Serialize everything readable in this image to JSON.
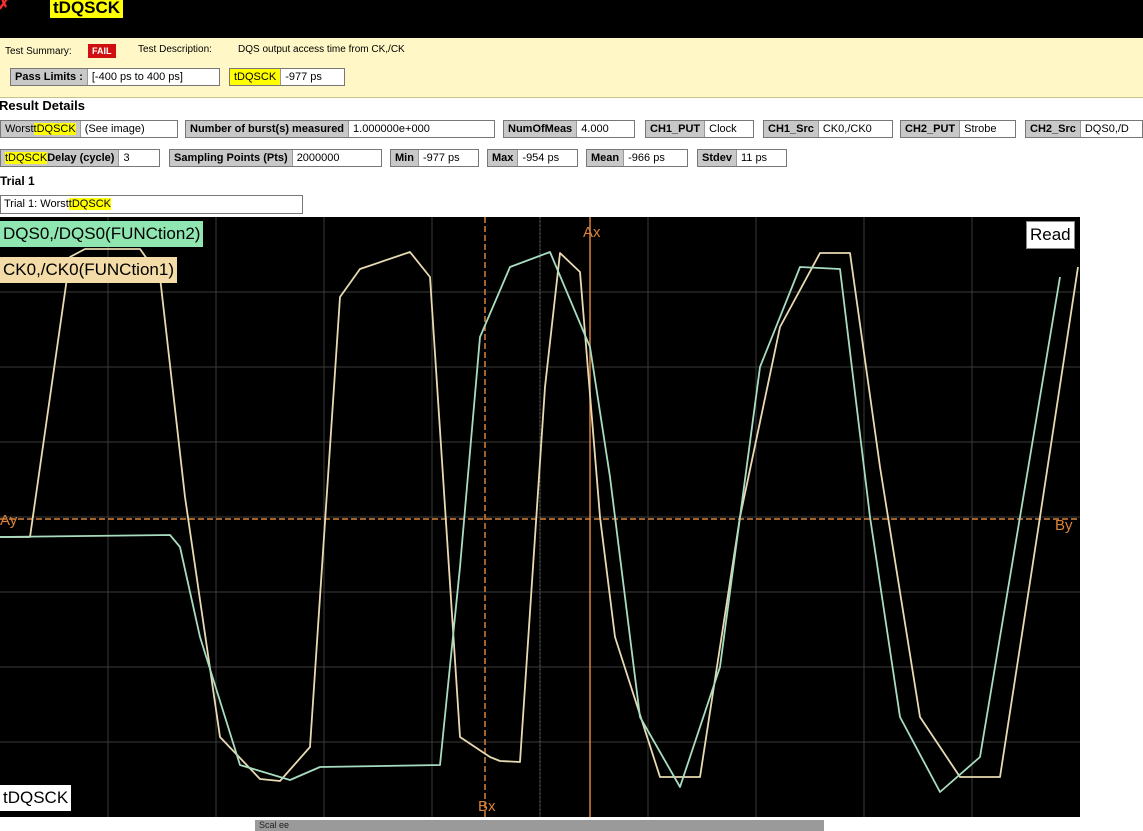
{
  "header": {
    "title": "tDQSCK"
  },
  "summary": {
    "test_summary_label": "Test Summary:",
    "status": "FAIL",
    "test_description_label": "Test Description:",
    "test_description": "DQS output access time from CK,/CK",
    "pass_limits_label": "Pass Limits :",
    "pass_limits_value": "[-400 ps to 400 ps]",
    "measure_name": "tDQSCK",
    "measure_value": "-977 ps"
  },
  "result_details": {
    "title": "Result Details",
    "row1": [
      {
        "label_prefix": "Worst",
        "label_hl": "tDQSCK",
        "value": "(See image)"
      },
      {
        "label": "Number of burst(s) measured",
        "value": "1.000000e+000"
      },
      {
        "label": "NumOfMeas",
        "value": "4.000"
      },
      {
        "label": "CH1_PUT",
        "value": "Clock"
      },
      {
        "label": "CH1_Src",
        "value": "CK0,/CK0"
      },
      {
        "label": "CH2_PUT",
        "value": "Strobe"
      },
      {
        "label": "CH2_Src",
        "value": "DQS0,/D"
      }
    ],
    "row2": [
      {
        "label_hl": "tDQSCK",
        "label_suffix": "Delay (cycle)",
        "value": "3"
      },
      {
        "label": "Sampling Points (Pts)",
        "value": "2000000"
      },
      {
        "label": "Min",
        "value": "-977 ps"
      },
      {
        "label": "Max",
        "value": "-954 ps"
      },
      {
        "label": "Mean",
        "value": "-966 ps"
      },
      {
        "label": "Stdev",
        "value": "11 ps"
      }
    ]
  },
  "trial": {
    "section": "Trial 1",
    "box_prefix": "Trial 1: Worst",
    "box_hl": "tDQSCK"
  },
  "scope": {
    "ch2_label": "DQS0,/DQS0(FUNCtion2)",
    "ch1_label": "CK0,/CK0(FUNCtion1)",
    "read_label": "Read",
    "measure_label": "tDQSCK",
    "marker_ax": "Ax",
    "marker_bx": "Bx",
    "marker_ay": "Ay",
    "marker_by": "By",
    "colors": {
      "background": "#000000",
      "grid": "#3a3a3a",
      "ch1_trace": "#e8d9b0",
      "ch2_trace": "#a8dcc0",
      "marker": "#d9833a",
      "ch1_label_bg": "#f3dca8",
      "ch2_label_bg": "#8fe6b0"
    }
  },
  "footer": {
    "scroll_label": "Scal ee"
  }
}
